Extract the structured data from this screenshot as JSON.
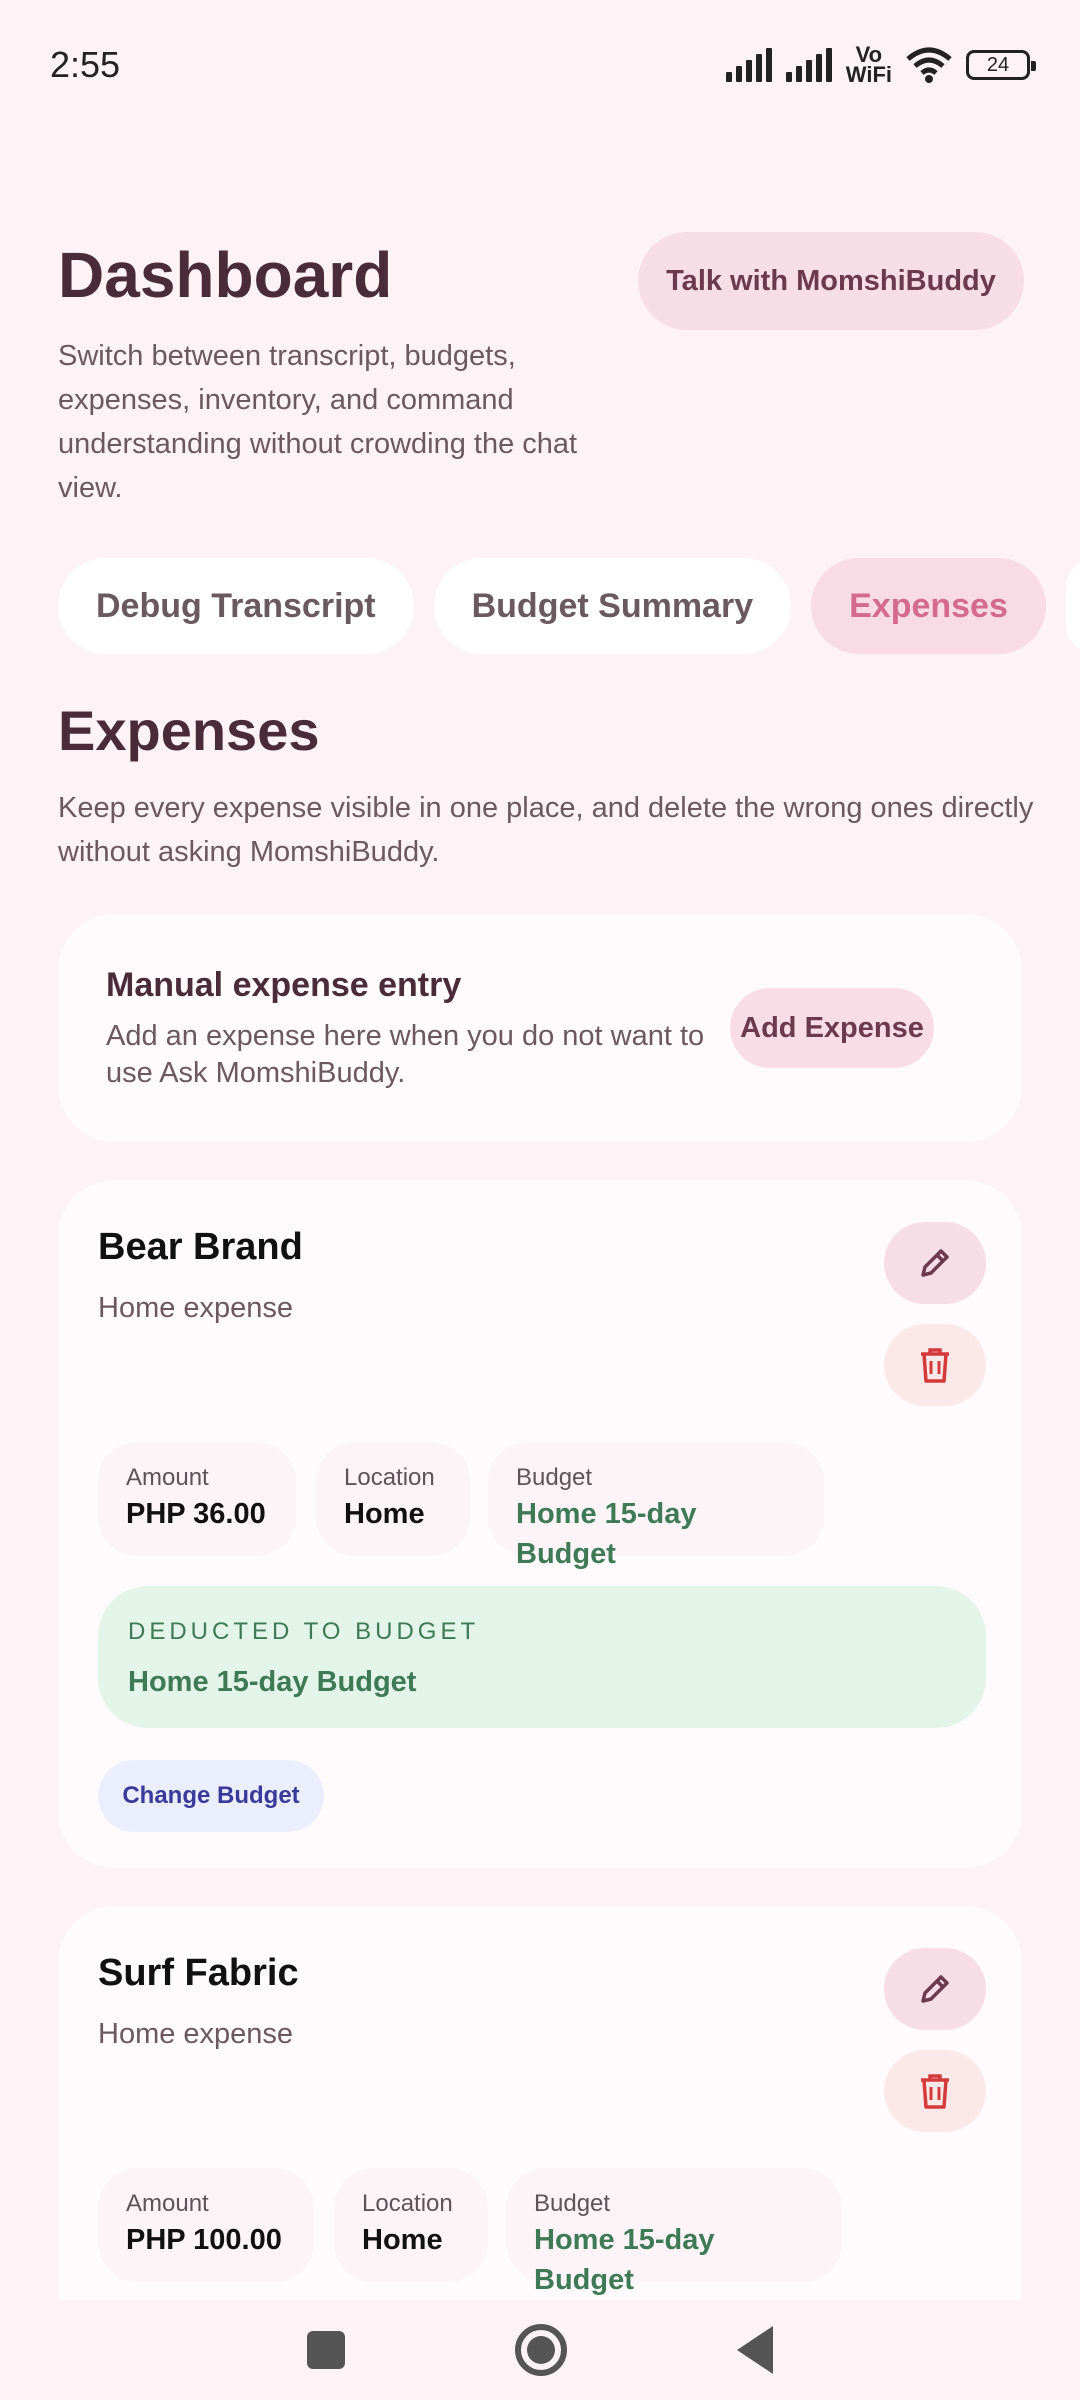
{
  "status_bar": {
    "time": "2:55",
    "wifi_label": "Vo\nWiFi",
    "battery": "24"
  },
  "header": {
    "title": "Dashboard",
    "subtitle": "Switch between transcript, budgets, expenses, inventory, and command understanding without crowding the chat view.",
    "talk_button": "Talk with MomshiBuddy"
  },
  "tabs": [
    {
      "label": "Debug Transcript",
      "active": false
    },
    {
      "label": "Budget Summary",
      "active": false
    },
    {
      "label": "Expenses",
      "active": true
    }
  ],
  "section": {
    "title": "Expenses",
    "description": "Keep every expense visible in one place, and delete the wrong ones directly without asking MomshiBuddy."
  },
  "manual_entry": {
    "title": "Manual expense entry",
    "description": "Add an expense here when you do not want to use Ask MomshiBuddy.",
    "button": "Add Expense"
  },
  "labels": {
    "amount": "Amount",
    "location": "Location",
    "budget": "Budget",
    "deducted": "DEDUCTED TO BUDGET",
    "change_budget": "Change Budget"
  },
  "expenses": [
    {
      "name": "Bear Brand",
      "category": "Home expense",
      "amount": "PHP 36.00",
      "location": "Home",
      "budget": "Home 15-day Budget",
      "deducted_budget": "Home 15-day Budget"
    },
    {
      "name": "Surf Fabric",
      "category": "Home expense",
      "amount": "PHP 100.00",
      "location": "Home",
      "budget": "Home 15-day Budget"
    }
  ],
  "colors": {
    "accent": "#d46a8e",
    "green": "#3d7a55",
    "delete_red": "#d43a3a"
  }
}
